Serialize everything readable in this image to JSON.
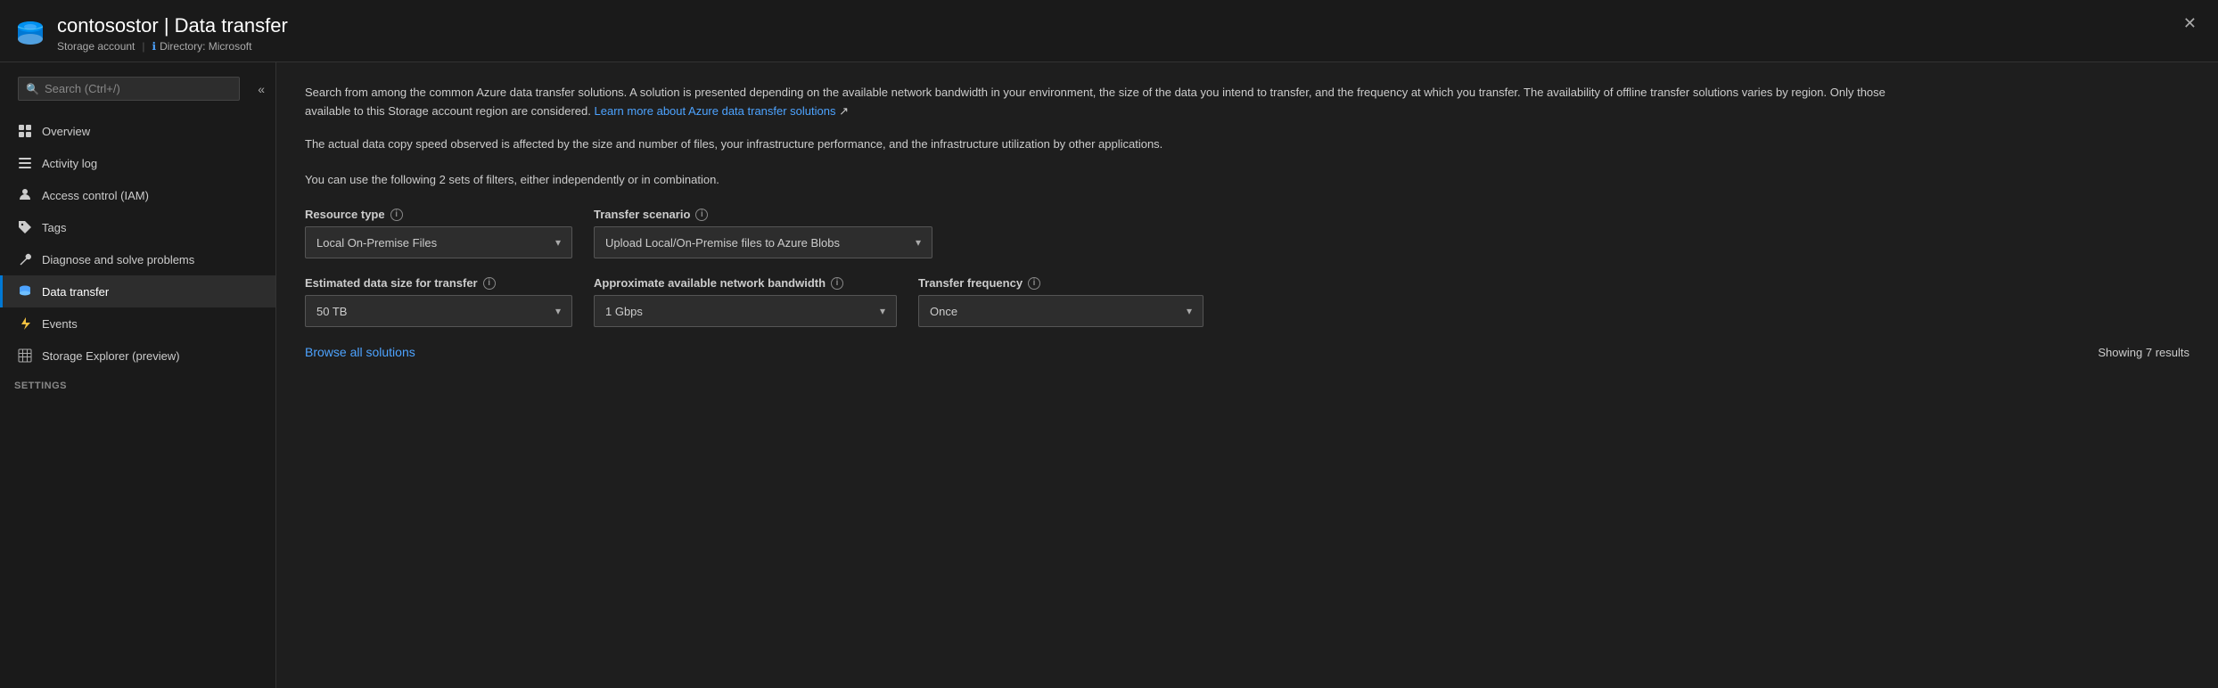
{
  "titleBar": {
    "icon": "storage-icon",
    "title": "contosostor | Data transfer",
    "subtitle1": "Storage account",
    "subtitle2": "Directory: Microsoft",
    "close": "✕"
  },
  "sidebar": {
    "searchPlaceholder": "Search (Ctrl+/)",
    "collapseIcon": "«",
    "navItems": [
      {
        "id": "overview",
        "label": "Overview",
        "icon": "grid-icon"
      },
      {
        "id": "activity-log",
        "label": "Activity log",
        "icon": "list-icon"
      },
      {
        "id": "access-control",
        "label": "Access control (IAM)",
        "icon": "person-icon"
      },
      {
        "id": "tags",
        "label": "Tags",
        "icon": "tag-icon"
      },
      {
        "id": "diagnose",
        "label": "Diagnose and solve problems",
        "icon": "wrench-icon"
      },
      {
        "id": "data-transfer",
        "label": "Data transfer",
        "icon": "bucket-icon",
        "active": true
      },
      {
        "id": "events",
        "label": "Events",
        "icon": "bolt-icon"
      },
      {
        "id": "storage-explorer",
        "label": "Storage Explorer (preview)",
        "icon": "table-icon"
      }
    ],
    "settingsHeader": "Settings"
  },
  "content": {
    "description1": "Search from among the common Azure data transfer solutions. A solution is presented depending on the available network bandwidth in your environment, the size of the data you intend to transfer, and the frequency at which you transfer. The availability of offline transfer solutions varies by region. Only those available to this Storage account region are considered.",
    "learnMoreText": "Learn more about Azure data transfer solutions",
    "description2": "The actual data copy speed observed is affected by the size and number of files, your infrastructure performance, and the infrastructure utilization by other applications.",
    "filterNote": "You can use the following 2 sets of filters, either independently or in combination.",
    "filters": {
      "resourceType": {
        "label": "Resource type",
        "value": "Local On-Premise Files"
      },
      "transferScenario": {
        "label": "Transfer scenario",
        "value": "Upload Local/On-Premise files to Azure Blobs"
      },
      "estimatedDataSize": {
        "label": "Estimated data size for transfer",
        "value": "50 TB"
      },
      "networkBandwidth": {
        "label": "Approximate available network bandwidth",
        "value": "1 Gbps"
      },
      "transferFrequency": {
        "label": "Transfer frequency",
        "value": "Once"
      }
    },
    "browseLink": "Browse all solutions",
    "resultsCount": "Showing 7 results"
  }
}
